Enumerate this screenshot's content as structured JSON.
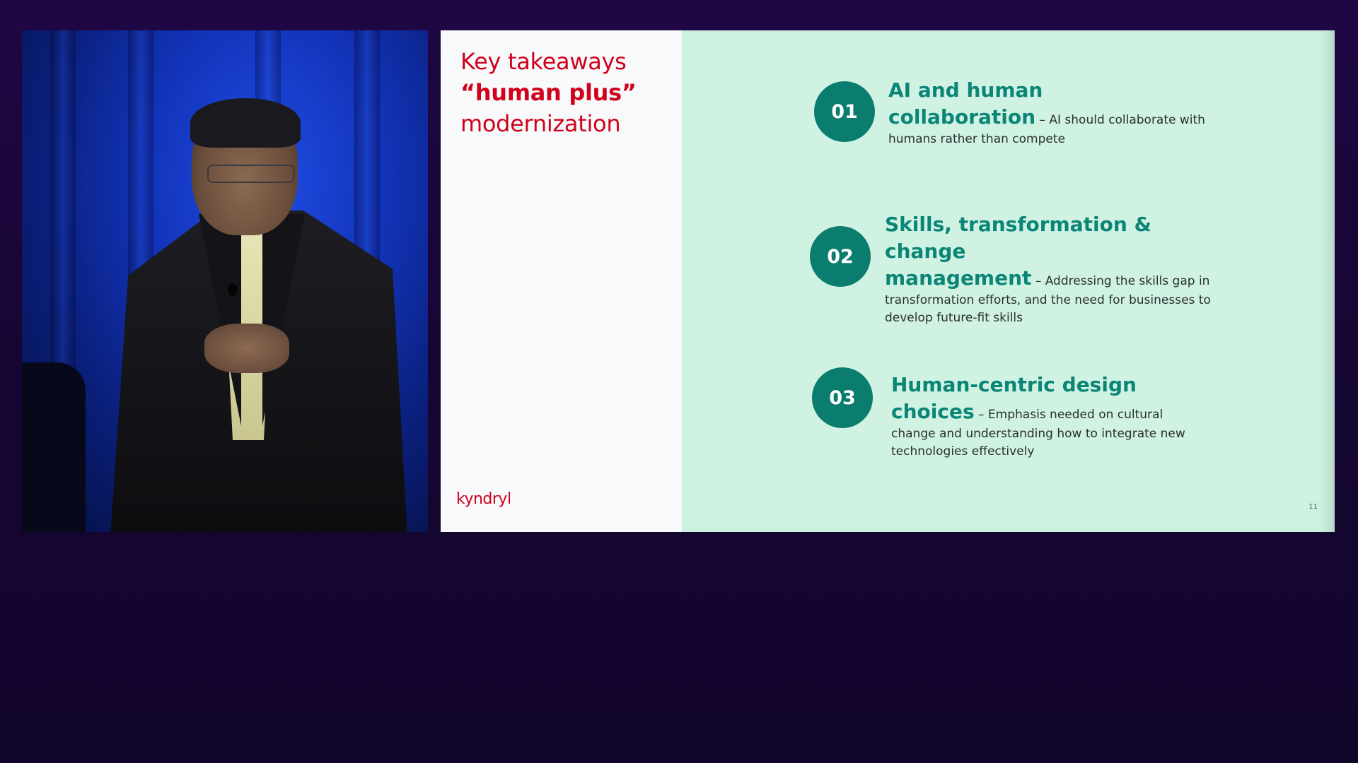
{
  "slide": {
    "title_line1": "Key takeaways",
    "title_line2": "“human plus”",
    "title_line3": "modernization",
    "brand": "kyndryl",
    "page_number": "11",
    "items": [
      {
        "number": "01",
        "heading_line1": "AI and human",
        "heading_line2": "collaboration",
        "description": " – AI should collaborate with humans rather than compete"
      },
      {
        "number": "02",
        "heading_line1": "Skills, transformation & change",
        "heading_line2": "management",
        "description": " – Addressing the skills gap in transformation efforts, and the need for businesses to develop future-fit skills"
      },
      {
        "number": "03",
        "heading_line1": "Human-centric design choices",
        "heading_line2": "",
        "description": " – Emphasis needed on cultural change and understanding how to integrate new technologies effectively"
      }
    ]
  },
  "colors": {
    "background": "#1a0838",
    "slide_background": "#cff2e3",
    "title_red": "#d0021b",
    "accent_teal": "#0a7d6f"
  }
}
